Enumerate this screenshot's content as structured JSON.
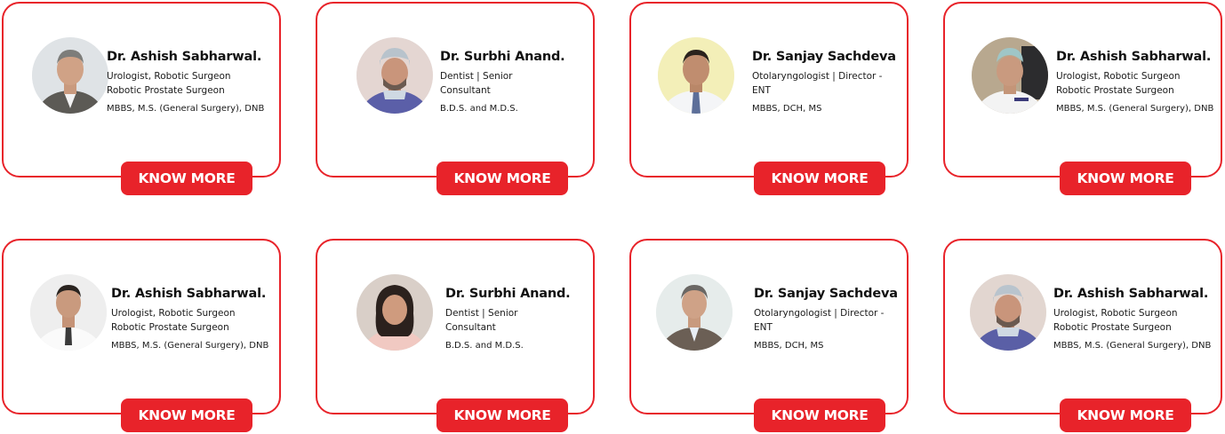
{
  "theme": {
    "accent": "#e8232a"
  },
  "button_label": "KNOW MORE",
  "doctors": [
    {
      "name": "Dr. Ashish Sabharwal.",
      "specialty_lines": [
        "Urologist, Robotic Surgeon",
        "Robotic Prostate Surgeon"
      ],
      "qualifications": "MBBS, M.S. (General Surgery), DNB",
      "photo": "doctor-photo-icon"
    },
    {
      "name": "Dr. Surbhi Anand.",
      "specialty_lines": [
        "Dentist | Senior",
        "Consultant"
      ],
      "qualifications": "B.D.S. and M.D.S.",
      "photo": "doctor-photo-icon"
    },
    {
      "name": "Dr. Sanjay Sachdeva",
      "specialty_lines": [
        "Otolaryngologist | Director -",
        "ENT"
      ],
      "qualifications": "MBBS, DCH, MS",
      "photo": "doctor-photo-icon"
    },
    {
      "name": "Dr. Ashish Sabharwal.",
      "specialty_lines": [
        "Urologist, Robotic Surgeon",
        "Robotic Prostate Surgeon"
      ],
      "qualifications": "MBBS, M.S. (General Surgery), DNB",
      "photo": "doctor-photo-icon"
    },
    {
      "name": "Dr. Ashish Sabharwal.",
      "specialty_lines": [
        "Urologist, Robotic Surgeon",
        "Robotic Prostate Surgeon"
      ],
      "qualifications": "MBBS, M.S. (General Surgery), DNB",
      "photo": "doctor-photo-icon"
    },
    {
      "name": "Dr. Surbhi Anand.",
      "specialty_lines": [
        "Dentist | Senior",
        "Consultant"
      ],
      "qualifications": "B.D.S. and M.D.S.",
      "photo": "doctor-photo-icon"
    },
    {
      "name": "Dr. Sanjay Sachdeva",
      "specialty_lines": [
        "Otolaryngologist | Director -",
        "ENT"
      ],
      "qualifications": "MBBS, DCH, MS",
      "photo": "doctor-photo-icon"
    },
    {
      "name": "Dr. Ashish Sabharwal.",
      "specialty_lines": [
        "Urologist, Robotic Surgeon",
        "Robotic Prostate Surgeon"
      ],
      "qualifications": "MBBS, M.S. (General Surgery), DNB",
      "photo": "doctor-photo-icon"
    }
  ]
}
